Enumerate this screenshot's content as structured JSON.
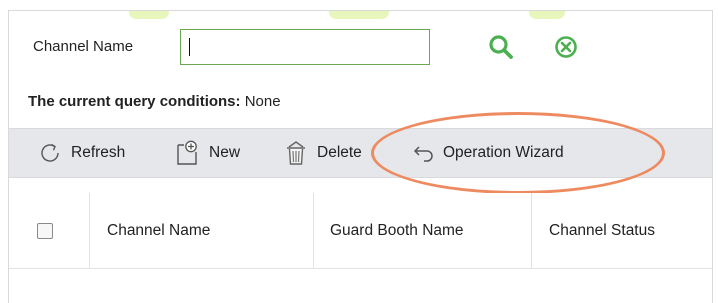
{
  "search": {
    "label": "Channel Name",
    "value": "",
    "placeholder": "",
    "search_icon": "search-icon",
    "clear_icon": "clear-circle-icon"
  },
  "query": {
    "label": "The current query conditions:",
    "value": "None"
  },
  "toolbar": {
    "refresh_label": "Refresh",
    "new_label": "New",
    "delete_label": "Delete",
    "wizard_label": "Operation Wizard"
  },
  "table": {
    "columns": [
      "Channel Name",
      "Guard Booth Name",
      "Channel Status"
    ],
    "rows": []
  },
  "colors": {
    "accent_green": "#4caf50",
    "toolbar_bg": "#e5e7ea",
    "highlight": "#ee8a5f"
  }
}
